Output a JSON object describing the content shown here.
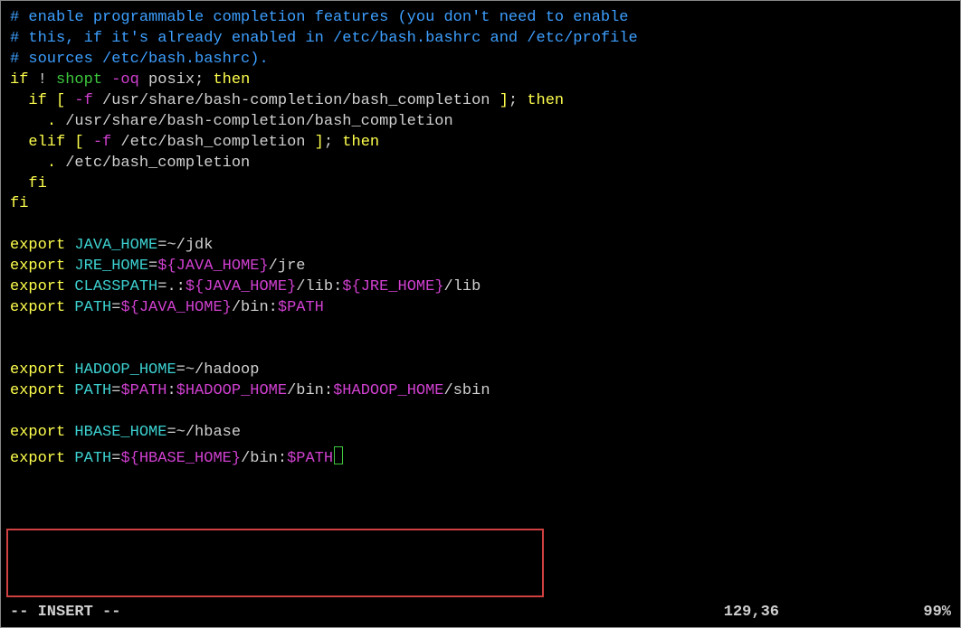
{
  "comments": {
    "l1": "# enable programmable completion features (you don't need to enable",
    "l2": "# this, if it's already enabled in /etc/bash.bashrc and /etc/profile",
    "l3": "# sources /etc/bash.bashrc)."
  },
  "code": {
    "if_kw": "if",
    "bang": " ! ",
    "shopt": "shopt",
    "oq": " -oq",
    "posix": " posix",
    "sc_then": "; ",
    "then_kw": "then",
    "indent2": "  ",
    "indent4": "    ",
    "lbrack": "[",
    "rbrack": " ]",
    "dashf": " -f",
    "bashcomp_path": " /usr/share/bash-completion/bash_completion",
    "dot": ". ",
    "bashcomp_path2": "/usr/share/bash-completion/bash_completion",
    "elif_kw": "elif",
    "etcbash_path": " /etc/bash_completion",
    "etcbash_path2": "/etc/bash_completion",
    "fi_kw": "fi",
    "export_kw": "export",
    "space": " ",
    "java_home": "JAVA_HOME",
    "eq": "=",
    "tilde_jdk": "~/jdk",
    "jre_home": "JRE_HOME",
    "var_java_home": "${JAVA_HOME}",
    "slash_jre": "/jre",
    "classpath": "CLASSPATH",
    "dotcolon": ".:",
    "slash_lib": "/lib",
    "colon": ":",
    "var_jre_home": "${JRE_HOME}",
    "path": "PATH",
    "slash_bin": "/bin",
    "var_path": "$PATH",
    "hadoop_home": "HADOOP_HOME",
    "tilde_hadoop": "~/hadoop",
    "var_hadoop_home": "$HADOOP_HOME",
    "slash_sbin": "/sbin",
    "hbase_home": "HBASE_HOME",
    "tilde_hbase": "~/hbase",
    "var_hbase_home": "${HBASE_HOME}"
  },
  "status": {
    "mode": "-- INSERT --",
    "position": "129,36",
    "percent": "99%"
  }
}
